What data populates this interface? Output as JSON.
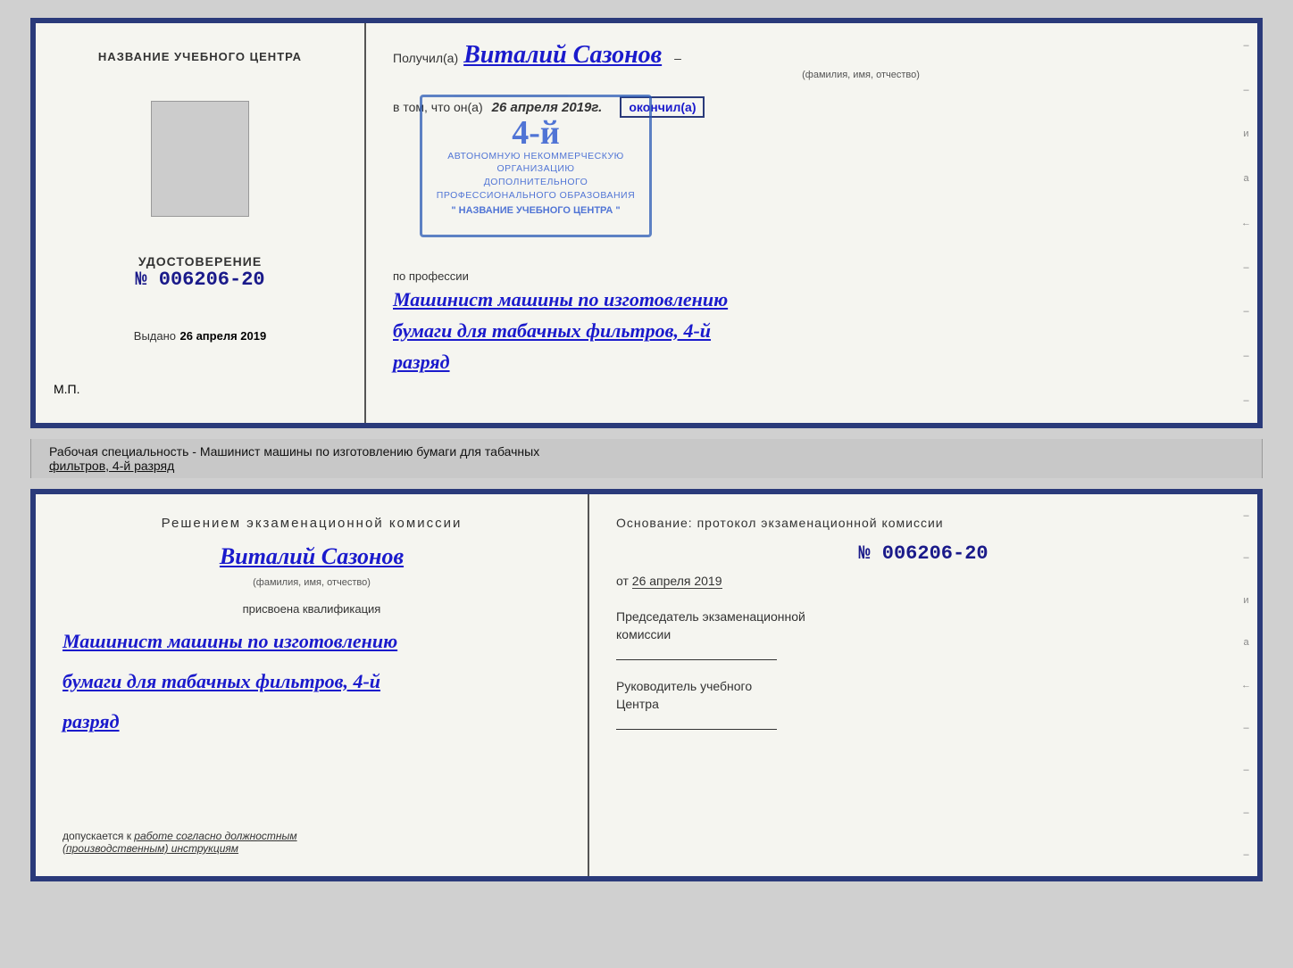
{
  "top_doc": {
    "left": {
      "center_label": "НАЗВАНИЕ УЧЕБНОГО ЦЕНТРА",
      "udostoverenie_title": "УДОСТОВЕРЕНИЕ",
      "number": "№ 006206-20",
      "vydano_label": "Выдано",
      "vydano_date": "26 апреля 2019",
      "mp": "М.П."
    },
    "right": {
      "poluchil_prefix": "Получил(а)",
      "recipient_name": "Виталий Сазонов",
      "fio_sub": "(фамилия, имя, отчество)",
      "dash": "–",
      "vtom_prefix": "в том, что он(а)",
      "vtom_date": "26 апреля 2019г.",
      "okonchil": "окончил(а)",
      "stamp_num": "4-й",
      "stamp_line1": "АВТОНОМНУЮ НЕКОММЕРЧЕСКУЮ ОРГАНИЗАЦИЮ",
      "stamp_line2": "ДОПОЛНИТЕЛЬНОГО ПРОФЕССИОНАЛЬНОГО ОБРАЗОВАНИЯ",
      "stamp_line3": "\" НАЗВАНИЕ УЧЕБНОГО ЦЕНТРА \"",
      "i_label": "и",
      "a_label": "а",
      "arrow_label": "←",
      "po_professii": "по профессии",
      "profession": "Машинист машины по изготовлению",
      "profession2": "бумаги для табачных фильтров, 4-й",
      "profession3": "разряд"
    }
  },
  "middle_strip": {
    "text": "Рабочая специальность - Машинист машины по изготовлению бумаги для табачных",
    "text2": "фильтров, 4-й разряд"
  },
  "bottom_doc": {
    "left": {
      "resheniyem": "Решением  экзаменационной  комиссии",
      "name": "Виталий  Сазонов",
      "fio_sub": "(фамилия, имя, отчество)",
      "prisvoena": "присвоена квалификация",
      "qualification1": "Машинист машины по изготовлению",
      "qualification2": "бумаги для табачных фильтров, 4-й",
      "qualification3": "разряд",
      "dopuskaetsya_prefix": "допускается к",
      "dopuskaetsya_cursive": "работе согласно должностным",
      "dopuskaetsya_cursive2": "(производственным) инструкциям"
    },
    "right": {
      "osnovanie": "Основание: протокол экзаменационной  комиссии",
      "number": "№  006206-20",
      "ot_prefix": "от",
      "ot_date": "26 апреля 2019",
      "predsedatel": "Председатель экзаменационной",
      "predsedatel2": "комиссии",
      "rukovoditel": "Руководитель учебного",
      "rukovoditel2": "Центра",
      "i_label": "и",
      "a_label": "а",
      "arrow_label": "←"
    }
  }
}
